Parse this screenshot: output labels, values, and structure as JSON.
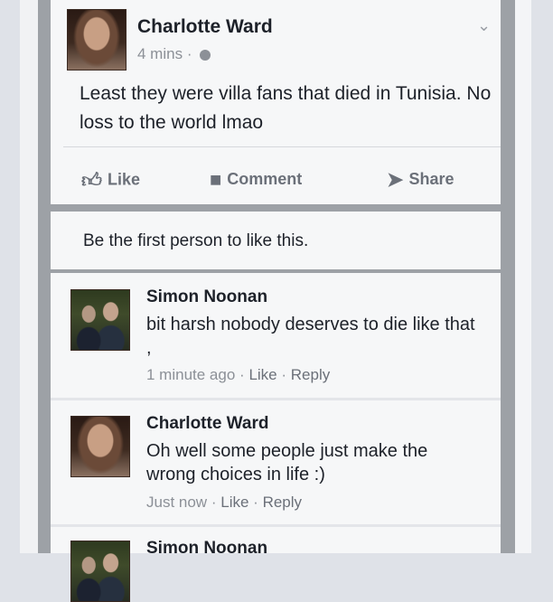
{
  "post": {
    "author": "Charlotte Ward",
    "time": "4 mins",
    "meta_sep": "·",
    "text": "Least they were villa fans that died in Tunisia. No loss to the world lmao",
    "menu_icon": "chevron-down-icon"
  },
  "actions": {
    "like": "Like",
    "comment": "Comment",
    "share": "Share"
  },
  "likes": {
    "text": "Be the first person to like this."
  },
  "comments": [
    {
      "author": "Simon Noonan",
      "text": "bit harsh nobody deserves to die like that ,",
      "time": "1 minute ago",
      "like": "Like",
      "reply": "Reply",
      "sep": "·"
    },
    {
      "author": "Charlotte Ward",
      "text": "Oh well some people just make the wrong choices in life :)",
      "time": "Just now",
      "like": "Like",
      "reply": "Reply",
      "sep": "·"
    },
    {
      "author": "Simon Noonan"
    }
  ],
  "colors": {
    "text": "#1d2129",
    "meta": "#8c9097",
    "background": "#f6f7f8"
  }
}
